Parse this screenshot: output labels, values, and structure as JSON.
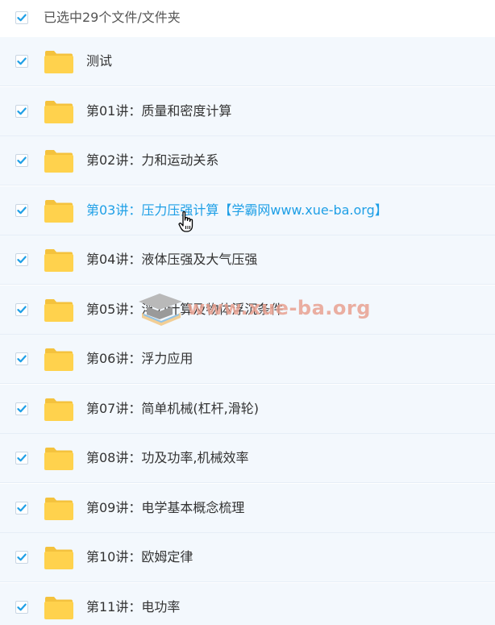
{
  "header": {
    "checked": true,
    "selection_text": "已选中29个文件/文件夹"
  },
  "colors": {
    "accent": "#1e9fe6",
    "row_bg": "#f3f8fd",
    "folder": "#ffd24d"
  },
  "rows": [
    {
      "name": "测试",
      "checked": true,
      "icon": "folder-icon"
    },
    {
      "name": "第01讲：质量和密度计算",
      "checked": true,
      "icon": "folder-icon"
    },
    {
      "name": "第02讲：力和运动关系",
      "checked": true,
      "icon": "folder-icon"
    },
    {
      "name": "第03讲：压力压强计算【学霸网www.xue-ba.org】",
      "checked": true,
      "icon": "folder-icon",
      "hovered": true
    },
    {
      "name": "第04讲：液体压强及大气压强",
      "checked": true,
      "icon": "folder-icon"
    },
    {
      "name": "第05讲：浮力计算及物体浮沉条件",
      "checked": true,
      "icon": "folder-icon"
    },
    {
      "name": "第06讲：浮力应用",
      "checked": true,
      "icon": "folder-icon"
    },
    {
      "name": "第07讲：简单机械(杠杆,滑轮)",
      "checked": true,
      "icon": "folder-icon"
    },
    {
      "name": "第08讲：功及功率,机械效率",
      "checked": true,
      "icon": "folder-icon"
    },
    {
      "name": "第09讲：电学基本概念梳理",
      "checked": true,
      "icon": "folder-icon"
    },
    {
      "name": "第10讲：欧姆定律",
      "checked": true,
      "icon": "folder-icon"
    },
    {
      "name": "第11讲：电功率",
      "checked": true,
      "icon": "folder-icon"
    }
  ],
  "watermark": {
    "text": "www.xue-ba.org",
    "icon": "graduation-cap-logo"
  }
}
